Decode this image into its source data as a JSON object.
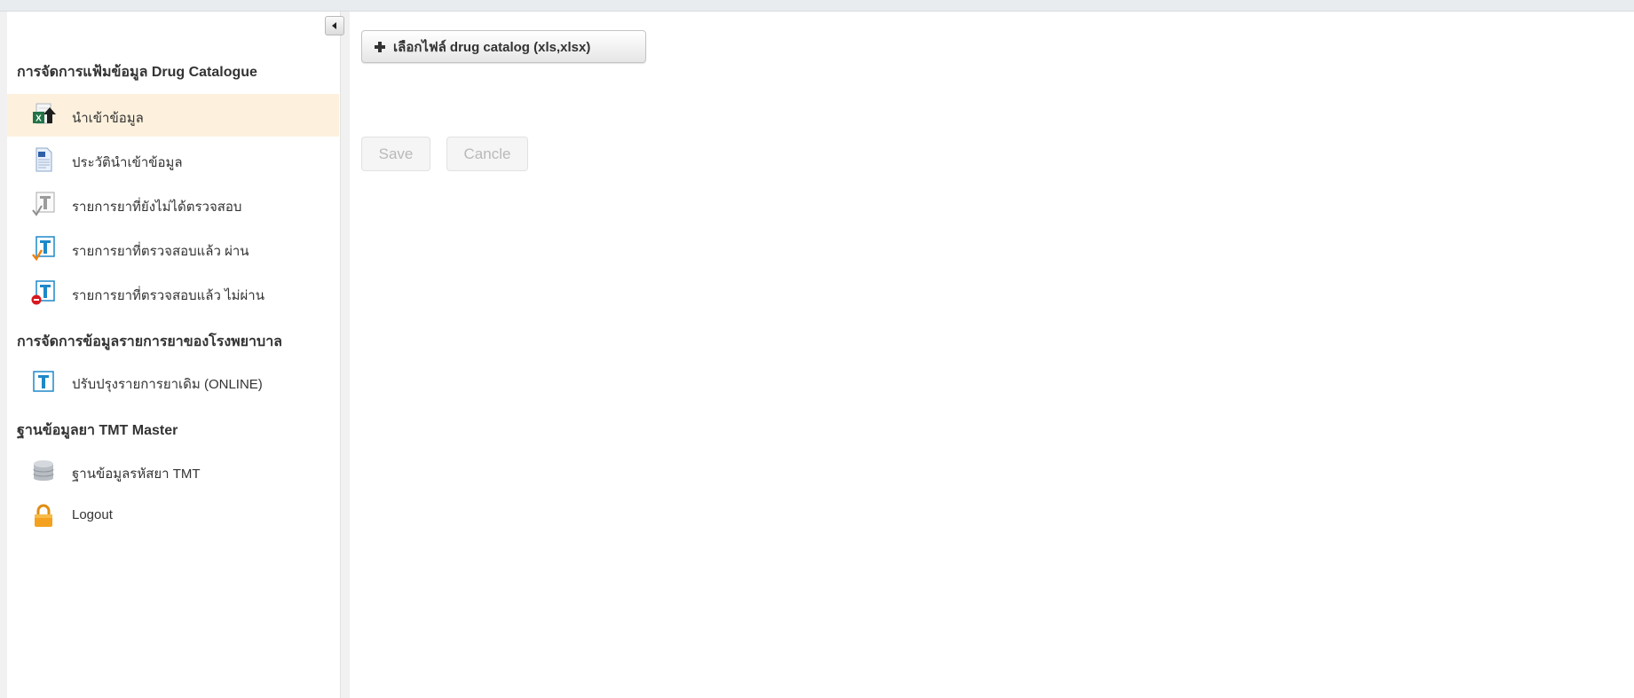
{
  "sidebar": {
    "sections": [
      "การจัดการแฟ้มข้อมูล Drug Catalogue",
      "การจัดการข้อมูลรายการยาของโรงพยาบาล",
      "ฐานข้อมูลยา TMT Master"
    ],
    "items": [
      {
        "label": "นำเข้าข้อมูล",
        "icon": "excel-upload-icon",
        "active": true
      },
      {
        "label": "ประวัตินำเข้าข้อมูล",
        "icon": "document-icon"
      },
      {
        "label": "รายการยาที่ยังไม่ได้ตรวจสอบ",
        "icon": "unchecked-text-icon"
      },
      {
        "label": "รายการยาที่ตรวจสอบแล้ว ผ่าน",
        "icon": "check-text-icon"
      },
      {
        "label": "รายการยาที่ตรวจสอบแล้ว ไม่ผ่าน",
        "icon": "reject-text-icon"
      },
      {
        "label": "ปรับปรุงรายการยาเดิม (ONLINE)",
        "icon": "text-icon"
      },
      {
        "label": "ฐานข้อมูลรหัสยา TMT",
        "icon": "database-icon"
      },
      {
        "label": "Logout",
        "icon": "lock-icon"
      }
    ]
  },
  "main": {
    "choose_file_label": "เลือกไฟล์ drug catalog (xls,xlsx)",
    "save_label": "Save",
    "cancel_label": "Cancle"
  },
  "colors": {
    "active_bg": "#fdf1dd",
    "icon_blue": "#1e88c8",
    "lock_orange": "#f3a11f"
  }
}
